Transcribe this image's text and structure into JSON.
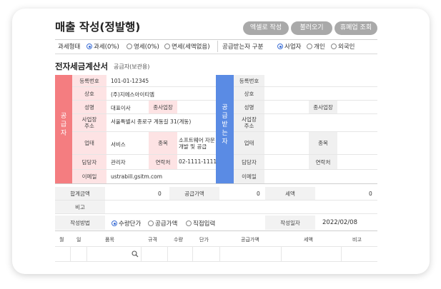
{
  "header": {
    "title": "매출 작성(정발행)",
    "buttons": [
      "엑셀로 작성",
      "불러오기",
      "휴폐업 조회"
    ]
  },
  "options_row": {
    "tax_type_label": "과세형태",
    "tax_types": [
      {
        "label": "과세(0%)",
        "selected": true
      },
      {
        "label": "영세(0%)",
        "selected": false
      },
      {
        "label": "면세(세액없음)",
        "selected": false
      }
    ],
    "receiver_label": "공급받는자 구분",
    "receiver_types": [
      {
        "label": "사업자",
        "selected": true
      },
      {
        "label": "개인",
        "selected": false
      },
      {
        "label": "외국인",
        "selected": false
      }
    ]
  },
  "invoice": {
    "title": "전자세금계산서",
    "subtitle": "공급자(보관용)",
    "supplier_side": "공급자",
    "receiver_side": "공급받는자",
    "supplier": {
      "reg_no_label": "등록번호",
      "reg_no": "101-01-12345",
      "company_label": "상호",
      "company": "(주)지에스아이티엠",
      "ceo_label": "성명",
      "ceo": "대표이사",
      "branch_label": "종사업장",
      "address_label": "사업장 주소",
      "address": "서울특별시 종로구 계동길 31(계동)",
      "biz_type_label": "업태",
      "biz_type": "서비스",
      "biz_item_label": "종목",
      "biz_item": "소프트웨어 자문 개발 및 공급",
      "manager_label": "담당자",
      "manager": "관리자",
      "phone_label": "연락처",
      "phone": "02-1111-1111",
      "email_label": "이메일",
      "email": "ustrabill.gsitm.com"
    },
    "receiver": {
      "reg_no_label": "등록번호",
      "company_label": "상호",
      "ceo_label": "성명",
      "branch_label": "종사업장",
      "address_label": "사업장 주소",
      "biz_type_label": "업태",
      "biz_item_label": "종목",
      "manager_label": "담당자",
      "phone_label": "연락처",
      "email_label": "이메일"
    }
  },
  "summary": {
    "total_label": "합계금액",
    "total": "0",
    "supply_label": "공급가액",
    "supply": "0",
    "tax_label": "세액",
    "tax": "0",
    "note_label": "비고",
    "method_label": "작성방법",
    "methods": [
      {
        "label": "수량단가",
        "selected": true
      },
      {
        "label": "공급가액",
        "selected": false
      },
      {
        "label": "직접입력",
        "selected": false
      }
    ],
    "date_label": "작성일자",
    "date": "2022/02/08"
  },
  "items_table": {
    "headers": [
      "월",
      "일",
      "품목",
      "규격",
      "수량",
      "단가",
      "공급가액",
      "세액",
      "비고"
    ]
  },
  "colors": {
    "supplier_accent": "#f47d80",
    "receiver_accent": "#5a8be4",
    "supplier_label_bg": "#fde3e4",
    "button_gray": "#a9a9a9",
    "radio_blue": "#3d6fd6"
  }
}
